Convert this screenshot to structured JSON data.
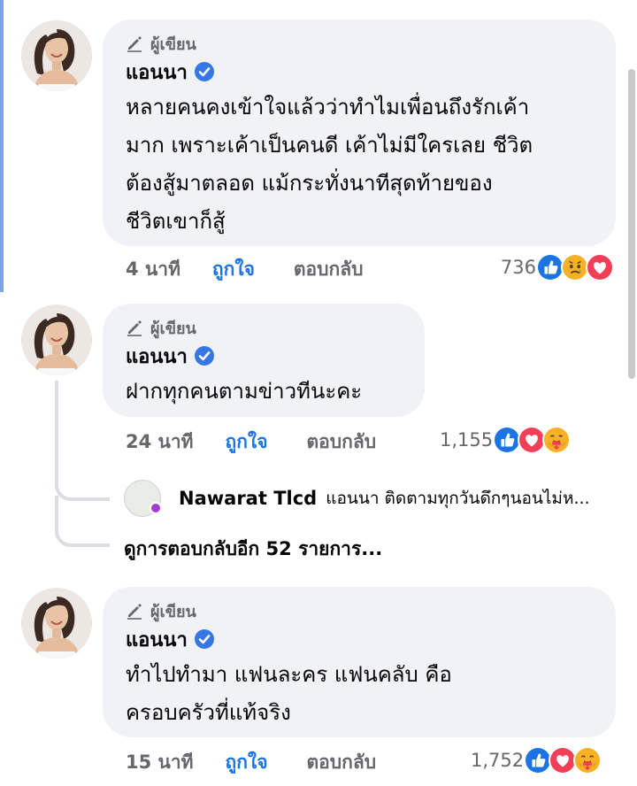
{
  "comments": [
    {
      "author_tag": "ผู้เขียน",
      "name": "แอนนา",
      "text": "หลายคนคงเข้าใจแล้วว่าทำไมเพื่อนถึงรักเค้า\nมาก เพราะเค้าเป็นคนดี เค้าไม่มีใครเลย ชีวิต\nต้องสู้มาตลอด แม้กระทั่งนาทีสุดท้ายของ\nชีวิตเขาก็สู้",
      "time": "4 นาที",
      "like_label": "ถูกใจ",
      "reply_label": "ตอบกลับ",
      "reaction_count": "736",
      "reaction_icons": [
        "like-icon",
        "sad-icon",
        "love-icon"
      ]
    },
    {
      "author_tag": "ผู้เขียน",
      "name": "แอนนา",
      "text": "ฝากทุกคนตามข่าวทีนะคะ",
      "time": "24 นาที",
      "like_label": "ถูกใจ",
      "reply_label": "ตอบกลับ",
      "reaction_count": "1,155",
      "reaction_icons": [
        "like-icon",
        "love-icon",
        "care-icon"
      ],
      "nested_reply": {
        "name": "Nawarat Tlcd",
        "text": "แอนนา ติดตามทุกวันดึกๆนอนไม่ห..."
      },
      "more_replies": "ดูการตอบกลับอีก 52 รายการ..."
    },
    {
      "author_tag": "ผู้เขียน",
      "name": "แอนนา",
      "text": "ทำไปทำมา แฟนละคร แฟนคลับ คือ\nครอบครัวที่แท้จริง",
      "time": "15 นาที",
      "like_label": "ถูกใจ",
      "reply_label": "ตอบกลับ",
      "reaction_count": "1,752",
      "reaction_icons": [
        "like-icon",
        "love-icon",
        "care-icon"
      ]
    }
  ],
  "colors": {
    "like_blue": "#1b74e4",
    "love_red": "#f33e58",
    "reaction_yellow": "#f7b125",
    "bubble_bg": "#f0f2f5",
    "meta_gray": "#65676b"
  }
}
